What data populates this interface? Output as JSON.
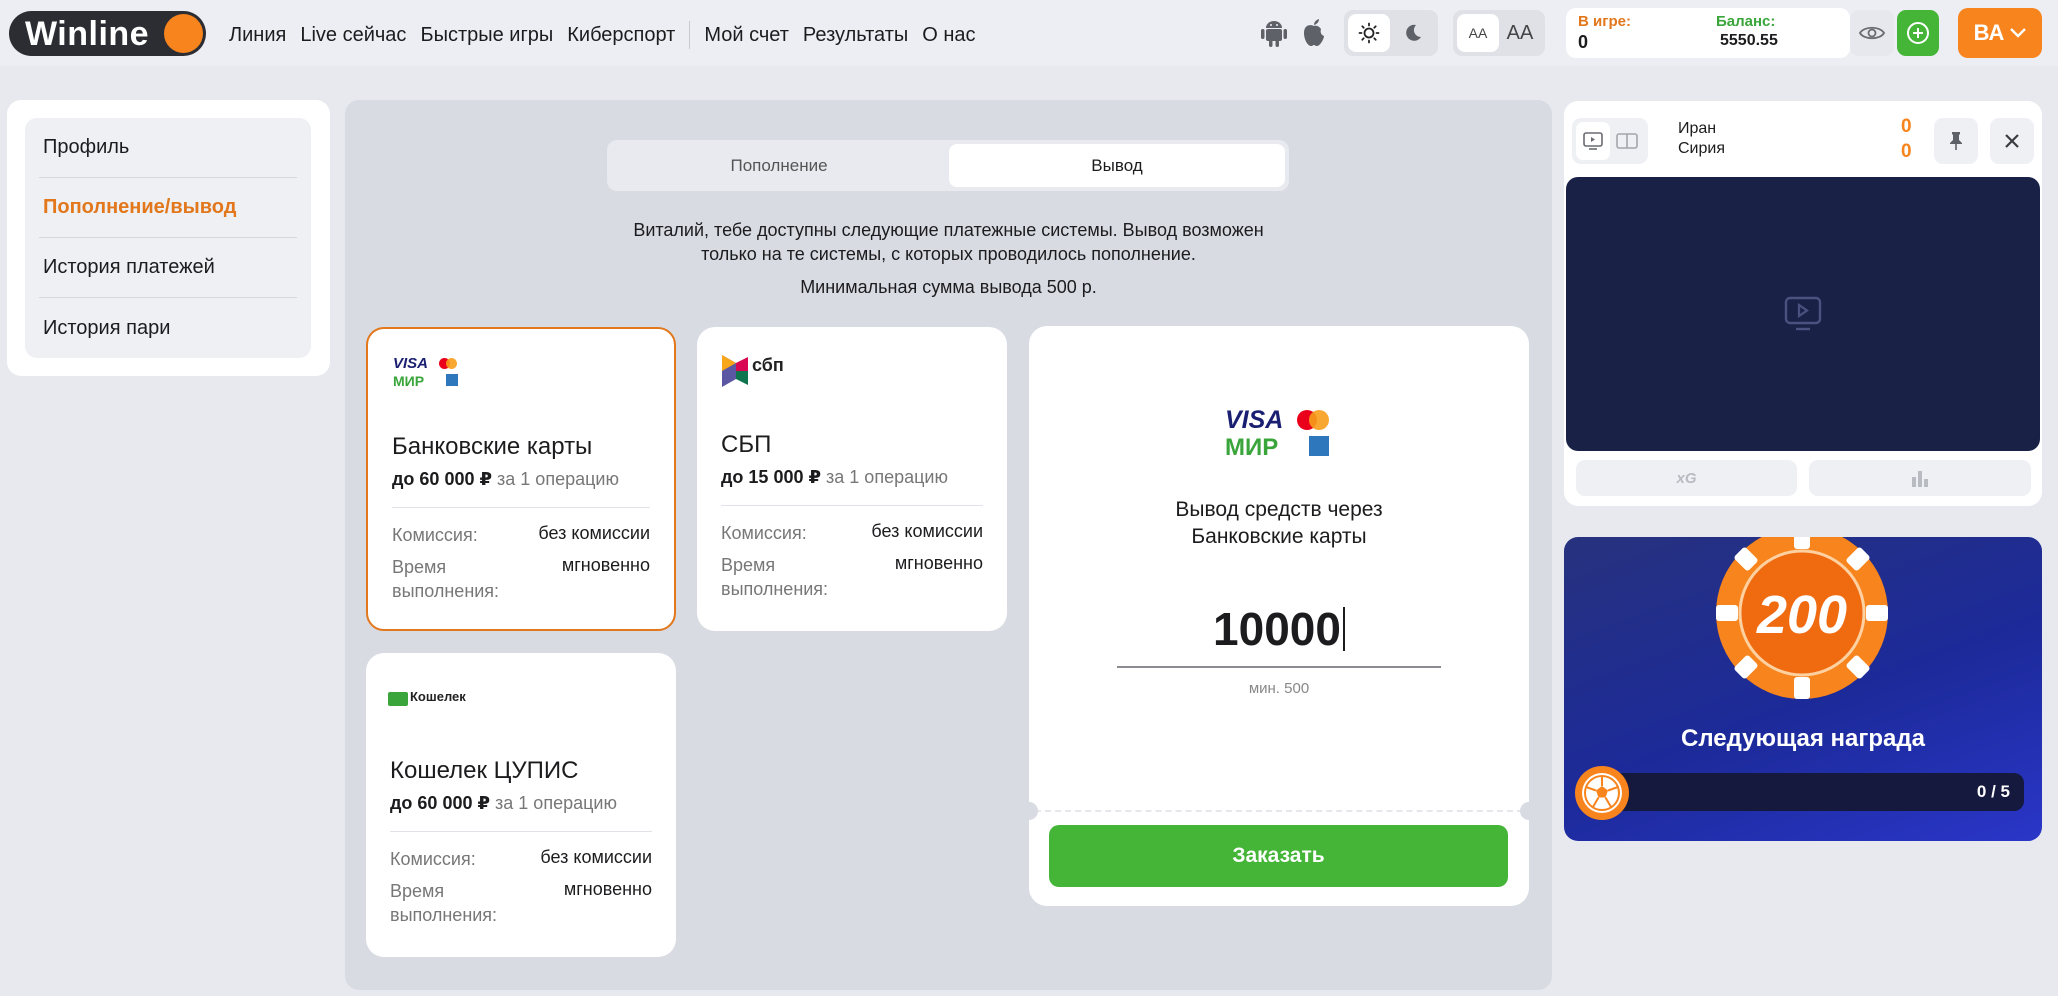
{
  "header": {
    "logo_text": "Winline",
    "nav": [
      "Линия",
      "Live сейчас",
      "Быстрые игры",
      "Киберспорт"
    ],
    "nav_secondary": [
      "Мой счет",
      "Результаты",
      "О нас"
    ],
    "font_small_label": "AA",
    "font_large_label": "AA",
    "in_game_label": "В игре:",
    "in_game_value": "0",
    "balance_label": "Баланс:",
    "balance_value": "5550.55",
    "user_initials": "ВА"
  },
  "sidebar": {
    "items": [
      {
        "label": "Профиль",
        "active": false
      },
      {
        "label": "Пополнение/вывод",
        "active": true
      },
      {
        "label": "История платежей",
        "active": false
      },
      {
        "label": "История пари",
        "active": false
      }
    ]
  },
  "main": {
    "tabs": [
      {
        "label": "Пополнение",
        "active": false
      },
      {
        "label": "Вывод",
        "active": true
      }
    ],
    "info_line1": "Виталий, тебе доступны следующие платежные системы. Вывод возможен",
    "info_line2": "только на те системы, с которых проводилось пополнение.",
    "min_withdraw": "Минимальная сумма вывода 500 р.",
    "cards": [
      {
        "title": "Банковские карты",
        "limit": "до 60 000 ₽",
        "limit_suffix": "за 1 операцию",
        "commission_label": "Комиссия:",
        "commission_value": "без комиссии",
        "time_label_1": "Время",
        "time_label_2": "выполнения:",
        "time_value": "мгновенно",
        "logo_visa": "VISA",
        "logo_mir": "МИР"
      },
      {
        "title": "СБП",
        "limit": "до 15 000 ₽",
        "limit_suffix": "за 1 операцию",
        "commission_label": "Комиссия:",
        "commission_value": "без комиссии",
        "time_label_1": "Время",
        "time_label_2": "выполнения:",
        "time_value": "мгновенно",
        "logo_text": "сбп"
      },
      {
        "title": "Кошелек ЦУПИС",
        "limit": "до 60 000 ₽",
        "limit_suffix": "за 1 операцию",
        "commission_label": "Комиссия:",
        "commission_value": "без комиссии",
        "time_label_1": "Время",
        "time_label_2": "выполнения:",
        "time_value": "мгновенно",
        "logo_text": "Кошелек"
      }
    ],
    "withdraw": {
      "logo_visa": "VISA",
      "logo_mir": "МИР",
      "title_line1": "Вывод средств через",
      "title_line2": "Банковские карты",
      "amount": "10000",
      "min_hint": "мин. 500",
      "button": "Заказать"
    }
  },
  "match": {
    "team1": "Иран",
    "team2": "Сирия",
    "score1": "0",
    "score2": "0",
    "xg_label": "xG"
  },
  "promo": {
    "chip_value": "200",
    "title": "Следующая награда",
    "progress_text": "0 / 5",
    "progress_value": 0
  },
  "colors": {
    "accent": "#f7841c",
    "green": "#45b538",
    "dark_video": "#1a2147"
  }
}
